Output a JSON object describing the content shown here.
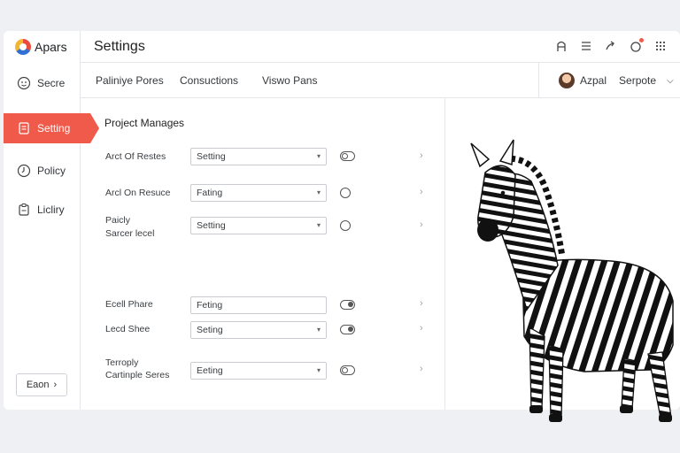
{
  "app": {
    "brand_name": "Apars",
    "page_title": "Settings"
  },
  "sidebar": {
    "items": [
      {
        "label": "Secre",
        "icon": "face-icon"
      },
      {
        "label": "Setting",
        "icon": "document-icon",
        "active": true
      },
      {
        "label": "Policy",
        "icon": "clock-icon"
      },
      {
        "label": "Licliry",
        "icon": "clipboard-icon"
      }
    ],
    "footer_button": "Eaon"
  },
  "topbar": {
    "icons": [
      "user-icon",
      "menu-icon",
      "share-icon",
      "notification-icon",
      "grid-icon"
    ]
  },
  "tabs": [
    "Paliniye Pores",
    "Consuctions",
    "Viswo Pans"
  ],
  "user": {
    "first_name": "Azpal",
    "last_name": "Serpote"
  },
  "section": {
    "title": "Project Manages",
    "rows": [
      {
        "label_line1": "Arct Of Restes",
        "label_line2": "",
        "value": "Setting",
        "control": "toggle-left"
      },
      {
        "label_line1": "Arcl On Resuce",
        "label_line2": "",
        "value": "Fating",
        "control": "radio"
      },
      {
        "label_line1": "Paicly",
        "label_line2": "Sarcer lecel",
        "value": "Setting",
        "control": "radio"
      },
      {
        "label_line1": "Ecell Phare",
        "label_line2": "",
        "value": "Feting",
        "control": "toggle-right"
      },
      {
        "label_line1": "Lecd Shee",
        "label_line2": "",
        "value": "Seting",
        "control": "toggle-right"
      },
      {
        "label_line1": "Terroply",
        "label_line2": "Cartinple Seres",
        "value": "Eeting",
        "control": "toggle-left"
      }
    ]
  },
  "colors": {
    "accent": "#f05a4a",
    "border": "#e4e6e9"
  }
}
